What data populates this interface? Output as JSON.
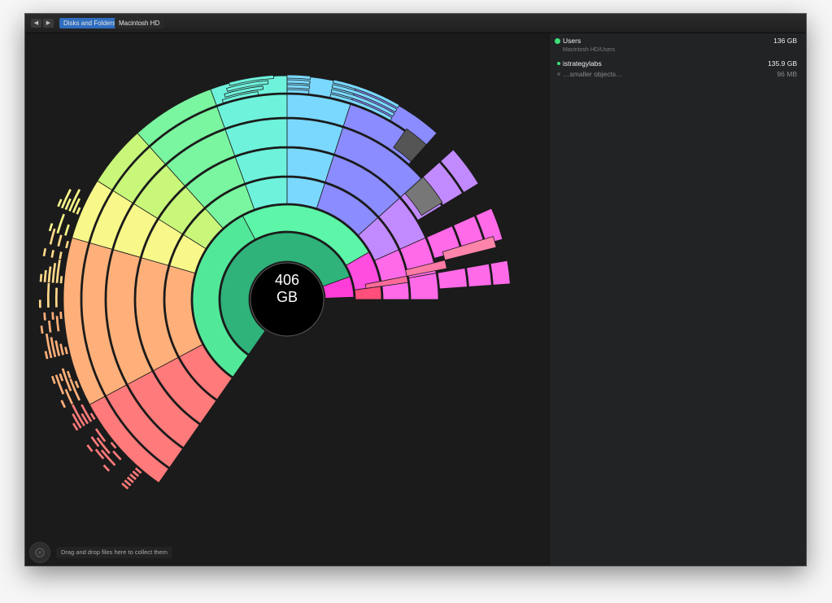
{
  "toolbar": {
    "back_label": "◀",
    "forward_label": "▶",
    "breadcrumbs": [
      "Disks and Folders",
      "Macintosh HD"
    ]
  },
  "chart": {
    "center_value": "406",
    "center_unit": "GB"
  },
  "bottom": {
    "drop_hint": "Drag and drop files here to collect them"
  },
  "side_panel": {
    "header_item": {
      "name": "Users",
      "size": "136 GB",
      "path": "Macintosh HD/Users",
      "color": "#3ee07a"
    },
    "items": [
      {
        "name": "istrategylabs",
        "size": "135.9 GB",
        "color": "#3ee07a"
      },
      {
        "name": "…smaller objects…",
        "size": "96   MB",
        "color": "#4a4a4a"
      }
    ]
  },
  "colors": {
    "window_bg": "#1b1b1b",
    "panel_bg": "#222325",
    "breadcrumb_active": "#2f6dbf"
  }
}
